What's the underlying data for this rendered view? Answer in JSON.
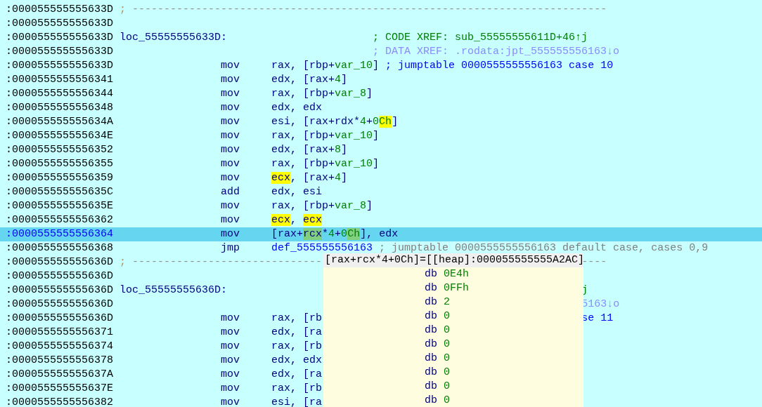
{
  "listing": {
    "rows": [
      {
        "address": ":000055555555633D",
        "selected": false,
        "comment": [
          {
            "text": ";",
            "kind": "sep"
          },
          {
            "text": " ---------------------------------------------------------------------------",
            "kind": "rule"
          }
        ]
      },
      {
        "address": ":000055555555633D",
        "selected": false
      },
      {
        "address": ":000055555555633D",
        "selected": false,
        "label": "loc_55555555633D:",
        "comment": [
          {
            "text": "; CODE XREF: sub_55555555611D+46↑j",
            "kind": "code-xref"
          }
        ]
      },
      {
        "address": ":000055555555633D",
        "selected": false,
        "label": "",
        "comment": [
          {
            "text": "; DATA XREF: .rodata:jpt_555555556163↓o",
            "kind": "data-xref"
          }
        ]
      },
      {
        "address": ":000055555555633D",
        "selected": false,
        "mnemonic": "mov",
        "operand": [
          {
            "text": "rax, [rbp+",
            "kind": "text"
          },
          {
            "text": "var_10",
            "kind": "var"
          },
          {
            "text": "]",
            "kind": "text"
          }
        ],
        "comment": [
          {
            "text": "; jumptable 0000555555556163 case 10",
            "kind": "note"
          }
        ]
      },
      {
        "address": ":0000555555556341",
        "selected": false,
        "mnemonic": "mov",
        "operand": [
          {
            "text": "edx, [rax+",
            "kind": "text"
          },
          {
            "text": "4",
            "kind": "num"
          },
          {
            "text": "]",
            "kind": "text"
          }
        ]
      },
      {
        "address": ":0000555555556344",
        "selected": false,
        "mnemonic": "mov",
        "operand": [
          {
            "text": "rax, [rbp+",
            "kind": "text"
          },
          {
            "text": "var_8",
            "kind": "var"
          },
          {
            "text": "]",
            "kind": "text"
          }
        ]
      },
      {
        "address": ":0000555555556348",
        "selected": false,
        "mnemonic": "mov",
        "operand": [
          {
            "text": "edx, edx",
            "kind": "text"
          }
        ]
      },
      {
        "address": ":000055555555634A",
        "selected": false,
        "mnemonic": "mov",
        "operand": [
          {
            "text": "esi, [rax+rdx*",
            "kind": "text"
          },
          {
            "text": "4",
            "kind": "num"
          },
          {
            "text": "+",
            "kind": "text"
          },
          {
            "text": "0",
            "kind": "num"
          },
          {
            "text": "Ch",
            "kind": "num",
            "highlighted": true
          },
          {
            "text": "]",
            "kind": "text"
          }
        ]
      },
      {
        "address": ":000055555555634E",
        "selected": false,
        "mnemonic": "mov",
        "operand": [
          {
            "text": "rax, [rbp+",
            "kind": "text"
          },
          {
            "text": "var_10",
            "kind": "var"
          },
          {
            "text": "]",
            "kind": "text"
          }
        ]
      },
      {
        "address": ":0000555555556352",
        "selected": false,
        "mnemonic": "mov",
        "operand": [
          {
            "text": "edx, [rax+",
            "kind": "text"
          },
          {
            "text": "8",
            "kind": "num"
          },
          {
            "text": "]",
            "kind": "text"
          }
        ]
      },
      {
        "address": ":0000555555556355",
        "selected": false,
        "mnemonic": "mov",
        "operand": [
          {
            "text": "rax, [rbp+",
            "kind": "text"
          },
          {
            "text": "var_10",
            "kind": "var"
          },
          {
            "text": "]",
            "kind": "text"
          }
        ]
      },
      {
        "address": ":0000555555556359",
        "selected": false,
        "mnemonic": "mov",
        "operand": [
          {
            "text": "ecx",
            "kind": "text",
            "highlighted": true
          },
          {
            "text": ", [rax+",
            "kind": "text"
          },
          {
            "text": "4",
            "kind": "num"
          },
          {
            "text": "]",
            "kind": "text"
          }
        ]
      },
      {
        "address": ":000055555555635C",
        "selected": false,
        "mnemonic": "add",
        "operand": [
          {
            "text": "edx, esi",
            "kind": "text"
          }
        ]
      },
      {
        "address": ":000055555555635E",
        "selected": false,
        "mnemonic": "mov",
        "operand": [
          {
            "text": "rax, [rbp+",
            "kind": "text"
          },
          {
            "text": "var_8",
            "kind": "var"
          },
          {
            "text": "]",
            "kind": "text"
          }
        ]
      },
      {
        "address": ":0000555555556362",
        "selected": false,
        "mnemonic": "mov",
        "operand": [
          {
            "text": "ecx",
            "kind": "text",
            "highlighted": true
          },
          {
            "text": ", ",
            "kind": "text"
          },
          {
            "text": "ecx",
            "kind": "text",
            "highlighted": true
          }
        ]
      },
      {
        "address": ":0000555555556364",
        "selected": true,
        "mnemonic": "mov",
        "operand": [
          {
            "text": "[rax+",
            "kind": "text"
          },
          {
            "text": "rcx",
            "kind": "text",
            "highlighted": true
          },
          {
            "text": "*",
            "kind": "text"
          },
          {
            "text": "4",
            "kind": "num"
          },
          {
            "text": "+",
            "kind": "text"
          },
          {
            "text": "0",
            "kind": "num"
          },
          {
            "text": "Ch",
            "kind": "num",
            "highlighted": true
          },
          {
            "text": "], edx",
            "kind": "text"
          }
        ]
      },
      {
        "address": ":0000555555556368",
        "selected": false,
        "mnemonic": "jmp",
        "operand": [
          {
            "text": "def_555555556163",
            "kind": "name"
          }
        ],
        "comment": [
          {
            "text": "; jumptable 0000555555556163 default case, cases 0,9",
            "kind": "auto"
          }
        ]
      },
      {
        "address": ":000055555555636D",
        "selected": false,
        "comment": [
          {
            "text": ";",
            "kind": "sep"
          },
          {
            "text": " ------------------------------",
            "kind": "rule"
          }
        ],
        "tail": {
          "text": "----",
          "kind": "rule"
        }
      },
      {
        "address": ":000055555555636D",
        "selected": false
      },
      {
        "address": ":000055555555636D",
        "selected": false,
        "label": "loc_55555555636D:",
        "tail": {
          "text": "j",
          "kind": "code-xref"
        }
      },
      {
        "address": ":000055555555636D",
        "selected": false,
        "tail": {
          "text": "5163↓o",
          "kind": "data-xref"
        }
      },
      {
        "address": ":000055555555636D",
        "selected": false,
        "mnemonic": "mov",
        "operand": [
          {
            "text": "rax, [rb",
            "kind": "text"
          }
        ],
        "tail": {
          "text": "se 11",
          "kind": "note"
        }
      },
      {
        "address": ":0000555555556371",
        "selected": false,
        "mnemonic": "mov",
        "operand": [
          {
            "text": "edx, [ra",
            "kind": "text"
          }
        ]
      },
      {
        "address": ":0000555555556374",
        "selected": false,
        "mnemonic": "mov",
        "operand": [
          {
            "text": "rax, [rb",
            "kind": "text"
          }
        ]
      },
      {
        "address": ":0000555555556378",
        "selected": false,
        "mnemonic": "mov",
        "operand": [
          {
            "text": "edx, edx",
            "kind": "text"
          }
        ]
      },
      {
        "address": ":000055555555637A",
        "selected": false,
        "mnemonic": "mov",
        "operand": [
          {
            "text": "edx, [ra",
            "kind": "text"
          }
        ]
      },
      {
        "address": ":000055555555637E",
        "selected": false,
        "mnemonic": "mov",
        "operand": [
          {
            "text": "rax, [rb",
            "kind": "text"
          }
        ]
      },
      {
        "address": ":0000555555556382",
        "selected": false,
        "mnemonic": "mov",
        "operand": [
          {
            "text": "esi, [ra",
            "kind": "text"
          }
        ]
      }
    ]
  },
  "tooltip": {
    "header": "[rax+rcx*4+0Ch]=[[heap]:000055555555A2AC]",
    "lines": [
      {
        "directive": "db",
        "value": "0E4h"
      },
      {
        "directive": "db",
        "value": "0FFh"
      },
      {
        "directive": "db",
        "value": "2"
      },
      {
        "directive": "db",
        "value": "0"
      },
      {
        "directive": "db",
        "value": "0"
      },
      {
        "directive": "db",
        "value": "0"
      },
      {
        "directive": "db",
        "value": "0"
      },
      {
        "directive": "db",
        "value": "0"
      },
      {
        "directive": "db",
        "value": "0"
      },
      {
        "directive": "db",
        "value": "0"
      }
    ]
  }
}
